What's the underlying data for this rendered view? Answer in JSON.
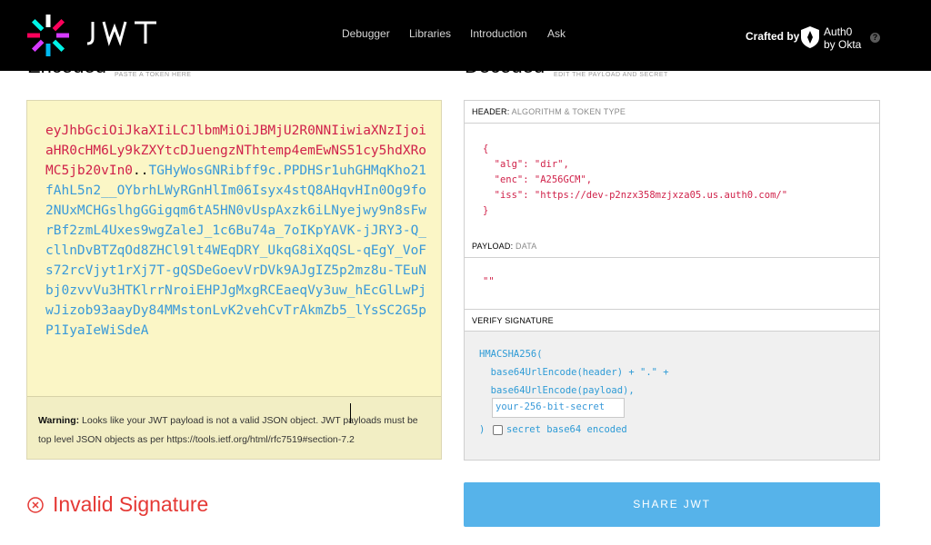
{
  "nav": {
    "brand": "JWT",
    "items": [
      "Debugger",
      "Libraries",
      "Introduction",
      "Ask"
    ],
    "crafted_by": "Crafted by",
    "partner_line1": "Auth0",
    "partner_line2": "by Okta",
    "help": "?"
  },
  "encoded": {
    "title": "Encoded",
    "subtitle": "PASTE A TOKEN HERE",
    "token_header_part": "eyJhbGciOiJkaXIiLCJlbmMiOiJBMjU2R0NNIiwiaXNzIjoiaHR0cHM6Ly9kZXYtcDJuengzNThtemp4emEwNS51cy5hdXRoMC5jb20vIn0",
    "token_dots": "..",
    "token_rest": "TGHyWosGNRibff9c.PPDHSr1uhGHMqKho21fAhL5n2__OYbrhLWyRGnHlIm06Isyx4stQ8AHqvHIn0Og9fo2NUxMCHGslhgGGigqm6tA5HN0vUspAxzk6iLNyejwy9n8sFwrBf2zmL4Uxes9wgZaleJ_1c6Bu74a_7oIKpYAVK-jJRY3-Q_cllnDvBTZqOd8ZHCl9lt4WEqDRY_UkqG8iXqQSL-qEgY_VoFs72rcVjyt1rXj7T-gQSDeGoevVrDVk9AJgIZ5p2mz8u-TEuNbj0zvvVu3HTKlrrNroiEHPJgMxgRCEaeqVy3uw_hEcGlLwPjwJizob93aayDy84MMstonLvK2vehCvTrAkmZb5_lYsSC2G5pP1IyaIeWiSdeA",
    "warning_label": "Warning:",
    "warning_text": " Looks like your JWT payload is not a valid JSON object. JWT payloads must be top level JSON objects as per https://tools.ietf.org/html/rfc7519#section-7.2",
    "invalid": "Invalid Signature"
  },
  "decoded": {
    "title": "Decoded",
    "subtitle": "EDIT THE PAYLOAD AND SECRET",
    "header_label": "HEADER:",
    "header_sub": "ALGORITHM & TOKEN TYPE",
    "header_lines": [
      "{",
      "  \"alg\": \"dir\",",
      "  \"enc\": \"A256GCM\",",
      "  \"iss\": \"https://dev-p2nzx358mzjxza05.us.auth0.com/\"",
      "}"
    ],
    "payload_label": "PAYLOAD:",
    "payload_sub": "DATA",
    "payload_value": "\"\"",
    "verify_label": "VERIFY SIGNATURE",
    "sig_lines": [
      "HMACSHA256(",
      "  base64UrlEncode(header) + \".\" +",
      "  base64UrlEncode(payload),"
    ],
    "secret_placeholder": "your-256-bit-secret",
    "sig_close": ")",
    "secret_b64_label": "secret base64 encoded"
  },
  "share_button": "SHARE JWT",
  "colors": {
    "accent": "#56b3ea",
    "token_header": "#d0224a",
    "token_body": "#3a9ad9",
    "invalid": "#e53935",
    "encoded_bg": "#fbf6c6"
  }
}
